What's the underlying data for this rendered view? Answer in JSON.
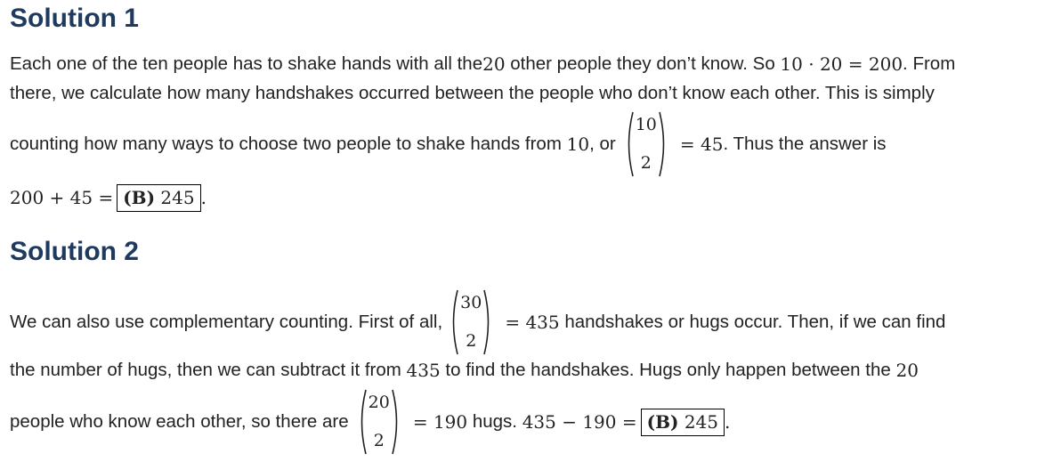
{
  "solution1": {
    "heading": "Solution 1",
    "line1_a": "Each one of the ten people has to shake hands with all the ",
    "line1_m1": "20",
    "line1_b": " other people they don’t know. So ",
    "line1_m2": "10 · 20 = 200",
    "line1_c": ". From",
    "line2": "there, we calculate how many handshakes occurred between the people who don’t know each other. This is simply",
    "line3_a": "counting how many ways to choose two people to shake hands from ",
    "line3_m1": "10",
    "line3_b": ", or",
    "line3_binom_top": "10",
    "line3_binom_bottom": "2",
    "line3_m2": "= 45",
    "line3_c": ". Thus the answer is",
    "line4_m": "200 + 45 =",
    "answer_letter": "(B)",
    "answer_value": "245",
    "line4_end": "."
  },
  "solution2": {
    "heading": "Solution 2",
    "line1_a": "We can also use complementary counting. First of all,",
    "line1_binom_top": "30",
    "line1_binom_bottom": "2",
    "line1_m": "= 435",
    "line1_b": " handshakes or hugs occur. Then, if we can find",
    "line2_a": "the number of hugs, then we can subtract it from ",
    "line2_m1": "435",
    "line2_b": " to find the handshakes. Hugs only happen between the ",
    "line2_m2": "20",
    "line3_a": "people who know each other, so there are",
    "line3_binom_top": "20",
    "line3_binom_bottom": "2",
    "line3_m1": "= 190",
    "line3_b": " hugs. ",
    "line3_m2": "435 − 190 =",
    "answer_letter": "(B)",
    "answer_value": "245",
    "line3_end": "."
  }
}
